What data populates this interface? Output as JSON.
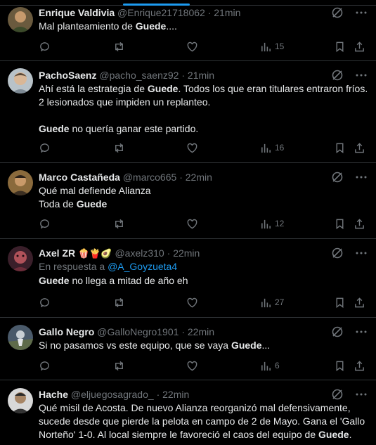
{
  "tweets": [
    {
      "name": "Enrique Valdivia",
      "handle": "@Enrique21718062",
      "time": "21min",
      "lines": [
        [
          "Mal planteamiento de ",
          "Guede",
          "...."
        ]
      ],
      "views": "15"
    },
    {
      "name": "PachoSaenz",
      "handle": "@pacho_saenz92",
      "time": "21min",
      "lines": [
        [
          "Ahí está la estrategia de ",
          "Guede",
          ". Todos los que eran titulares entraron fríos."
        ],
        [
          "2 lesionados que impiden un replanteo."
        ],
        [
          ""
        ],
        [
          "",
          "Guede",
          " no quería ganar este partido."
        ]
      ],
      "views": "16"
    },
    {
      "name": "Marco Castañeda",
      "handle": "@marco665",
      "time": "22min",
      "lines": [
        [
          "Qué mal defiende Alianza"
        ],
        [
          "Toda de ",
          "Guede",
          ""
        ]
      ],
      "views": "12"
    },
    {
      "name": "Axel ZR",
      "name_emojis": "🍿🍟🥑",
      "handle": "@axelz310",
      "time": "22min",
      "reply_prefix": "En respuesta a",
      "reply_mention": "@A_Goyzueta4",
      "lines": [
        [
          "",
          "Guede",
          " no llega a mitad de año eh"
        ]
      ],
      "views": "27"
    },
    {
      "name": "Gallo Negro",
      "handle": "@GalloNegro1901",
      "time": "22min",
      "lines": [
        [
          "Si no pasamos vs este equipo, que se vaya ",
          "Guede",
          "..."
        ]
      ],
      "views": "6"
    },
    {
      "name": "Hache",
      "handle": "@eljuegosagrado_",
      "time": "22min",
      "lines": [
        [
          "Qué misil de Acosta. De nuevo Alianza reorganizó mal defensivamente,"
        ],
        [
          "sucede desde que pierde la pelota en campo de 2 de Mayo. Gana el 'Gallo"
        ],
        [
          "Norteño' 1-0. Al local siempre le favoreció el caos del equipo de ",
          "Guede",
          "."
        ]
      ],
      "views": ""
    }
  ],
  "separator": "·",
  "icons": {
    "reply": "reply-icon",
    "retweet": "retweet-icon",
    "like": "heart-icon",
    "views": "views-icon",
    "bookmark": "bookmark-icon",
    "share": "share-icon",
    "grok": "grok-icon",
    "more": "more-icon"
  },
  "colors": {
    "background": "#000000",
    "text": "#e7e9ea",
    "muted": "#71767b",
    "accent": "#1d9bf0",
    "divider": "#2f3336"
  }
}
